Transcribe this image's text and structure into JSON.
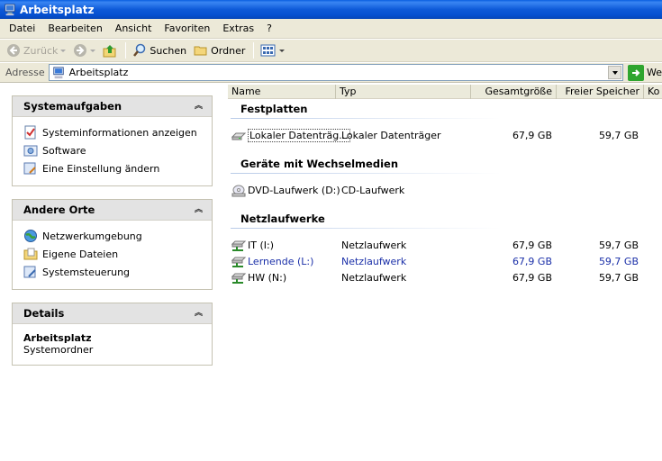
{
  "window": {
    "title": "Arbeitsplatz"
  },
  "menu": [
    {
      "label": "Datei"
    },
    {
      "label": "Bearbeiten"
    },
    {
      "label": "Ansicht"
    },
    {
      "label": "Favoriten"
    },
    {
      "label": "Extras"
    },
    {
      "label": "?"
    }
  ],
  "toolbar": {
    "back_label": "Zurück",
    "search_label": "Suchen",
    "folders_label": "Ordner"
  },
  "address": {
    "label": "Adresse",
    "value": "Arbeitsplatz",
    "go_label": "We"
  },
  "taskpane": {
    "system_tasks": {
      "title": "Systemaufgaben",
      "items": [
        {
          "label": "Systeminformationen anzeigen",
          "icon": "system-info-icon"
        },
        {
          "label": "Software",
          "icon": "software-icon"
        },
        {
          "label": "Eine Einstellung ändern",
          "icon": "settings-icon"
        }
      ]
    },
    "other_places": {
      "title": "Andere Orte",
      "items": [
        {
          "label": "Netzwerkumgebung",
          "icon": "network-icon"
        },
        {
          "label": "Eigene Dateien",
          "icon": "documents-folder-icon"
        },
        {
          "label": "Systemsteuerung",
          "icon": "control-panel-icon"
        }
      ]
    },
    "details": {
      "title": "Details",
      "name": "Arbeitsplatz",
      "type": "Systemordner"
    }
  },
  "columns": [
    "Name",
    "Typ",
    "Gesamtgröße",
    "Freier Speicher",
    "Ko"
  ],
  "groups": {
    "hard_disks": {
      "title": "Festplatten",
      "items": [
        {
          "name": "Lokaler Datenträg...",
          "type": "Lokaler Datenträger",
          "total": "67,9 GB",
          "free": "59,7 GB"
        }
      ]
    },
    "removable": {
      "title": "Geräte mit Wechselmedien",
      "items": [
        {
          "name": "DVD-Laufwerk (D:)",
          "type": "CD-Laufwerk",
          "total": "",
          "free": ""
        }
      ]
    },
    "network": {
      "title": "Netzlaufwerke",
      "items": [
        {
          "name": "IT (I:)",
          "type": "Netzlaufwerk",
          "total": "67,9 GB",
          "free": "59,7 GB"
        },
        {
          "name": "Lernende (L:)",
          "type": "Netzlaufwerk",
          "total": "67,9 GB",
          "free": "59,7 GB"
        },
        {
          "name": "HW (N:)",
          "type": "Netzlaufwerk",
          "total": "67,9 GB",
          "free": "59,7 GB"
        }
      ]
    }
  },
  "colors": {
    "title_bar": "#0550d0",
    "link_blue": "#1a2fa8",
    "panel_header": "#e3e3e3"
  }
}
